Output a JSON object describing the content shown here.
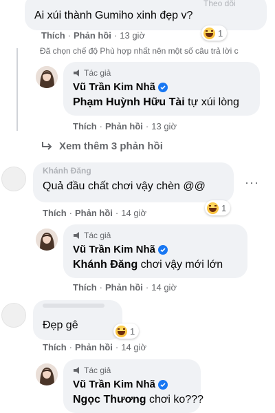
{
  "top": {
    "faded_header": "Theo dõi",
    "comment_text": "Ai xúi thành Gumiho xinh đẹp v?",
    "like_label": "Thích",
    "reply_label": "Phản hồi",
    "time": "13 giờ",
    "reaction_count": "1",
    "notice": "Đã chọn chế độ Phù hợp nhất nên một số câu trả lời c"
  },
  "reply1": {
    "author_tag": "Tác giả",
    "author_name": "Vũ Trần Kim Nhã",
    "mention": "Phạm Huỳnh Hữu Tài",
    "text": "tự xúi lòng",
    "like_label": "Thích",
    "reply_label": "Phản hồi",
    "time": "13 giờ"
  },
  "see_more": "Xem thêm 3 phản hồi",
  "comment2": {
    "name": "Khánh Đăng",
    "text": "Quả đầu chất chơi vậy chèn @@",
    "like_label": "Thích",
    "reply_label": "Phản hồi",
    "time": "14 giờ",
    "reaction_count": "1",
    "more": "···"
  },
  "reply2": {
    "author_tag": "Tác giả",
    "author_name": "Vũ Trần Kim Nhã",
    "mention": "Khánh Đăng",
    "text": "chơi vậy mới lớn",
    "like_label": "Thích",
    "reply_label": "Phản hồi",
    "time": "14 giờ"
  },
  "comment3": {
    "text": "Đẹp gê",
    "like_label": "Thích",
    "reply_label": "Phản hồi",
    "time": "14 giờ",
    "reaction_count": "1"
  },
  "reply3": {
    "author_tag": "Tác giả",
    "author_name": "Vũ Trần Kim Nhã",
    "mention": "Ngọc Thương",
    "text": "chơi ko???"
  },
  "colors": {
    "bubble": "#f0f2f5",
    "verified": "#1877f2",
    "secondary_text": "#65676b"
  }
}
